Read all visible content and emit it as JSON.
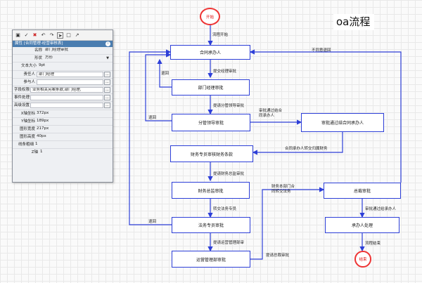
{
  "title": "oa流程",
  "colors": {
    "node_border": "#2d3fd8",
    "edge": "#2d3fd8",
    "terminal": "#e33333"
  },
  "nodes": {
    "start": "开始",
    "n1": "合同承办人",
    "n2": "部门经理审批",
    "n3": "分管领导审批",
    "n4": "审批通过结合同承办人",
    "n5": "财务专员审核财务条款",
    "n6": "财务总监审批",
    "n7": "法务专员审批",
    "n8": "运营管理部审批",
    "n9": "总裁审批",
    "n10": "承办人处理",
    "end": "结束"
  },
  "edges": {
    "e_start": "流程开始",
    "e_back_top": "不同意退回",
    "e_back1": "退回",
    "e_to_mgr": "提交经理审批",
    "e_back2": "退回",
    "e_to_lead": "提请分管领导审批",
    "e_pass": "审批通过结合同承办人",
    "e_contractor": "合同承办人转交归属财务",
    "e_to_cfo": "提请财务总监审批",
    "e_to_legal": "转交法务专员",
    "e_cross": "财务本部门合同转交法务",
    "e_back3": "退回",
    "e_to_ops": "提请运营管理部审",
    "e_to_ceo": "提请总裁审批",
    "e_ceo_pass": "审批通过给承办人",
    "e_end": "流程结束"
  },
  "panel": {
    "toolbar_icons": [
      "save-icon",
      "check-icon",
      "delete-icon",
      "undo-icon",
      "redo-icon",
      "pointer-icon",
      "rectangle-icon",
      "line-icon"
    ],
    "header": "属性 [合同管理-经营审核表]",
    "name_label": "名称",
    "name_value": "部门经理审批",
    "shape_label": "形状",
    "shape_value": "方形",
    "font_label": "文本大小",
    "font_value": "9pt",
    "responsible_label": "责任人",
    "responsible_value": "部门经理",
    "participant_label": "参与人",
    "participant_value": "",
    "field_label": "字段权限",
    "field_value": "业务相关另案条款,部门经理,",
    "event_label": "事件处理",
    "event_value": "",
    "advanced_label": "高级设置",
    "advanced_value": "",
    "x_label": "X轴坐标",
    "x_value": "372px",
    "y_label": "Y轴坐标",
    "y_value": "189px",
    "w_label": "图形宽度",
    "w_value": "217px",
    "h_label": "图形高度",
    "h_value": "40px",
    "border_label": "线条粗细",
    "border_value": "1",
    "z_label": "Z轴",
    "z_value": "1",
    "btn": "..."
  }
}
